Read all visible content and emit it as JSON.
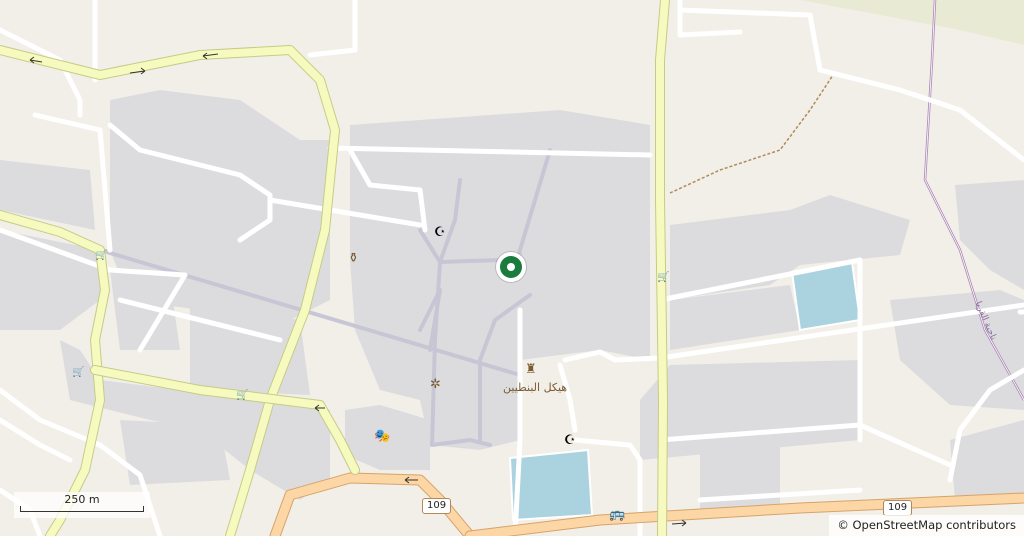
{
  "map": {
    "scale": {
      "label": "250 m"
    },
    "attribution": {
      "symbol": "©",
      "text": "OpenStreetMap contributors"
    },
    "road_shields": [
      "109",
      "109"
    ],
    "labels": {
      "temple": "هيكل البنطيين",
      "road_name": "ناحية القريا"
    },
    "marker": {
      "name": "location-pin",
      "color": "#1b7a3e"
    },
    "colors": {
      "background": "#f2efe9",
      "built_up": "#dcdcdf",
      "main_road": "#f7fabf",
      "main_road_casing": "#c6cb86",
      "secondary_road": "#fcd6a4",
      "minor_road": "#ffffff",
      "water": "#aad3df",
      "railway_boundary": "#b08ab8"
    },
    "icons": [
      "mosque-icon",
      "mosque-icon",
      "museum-vase-icon",
      "monument-icon",
      "theatre-icon",
      "viewpoint-icon",
      "bus-stop-icon",
      "shop-icon"
    ]
  }
}
